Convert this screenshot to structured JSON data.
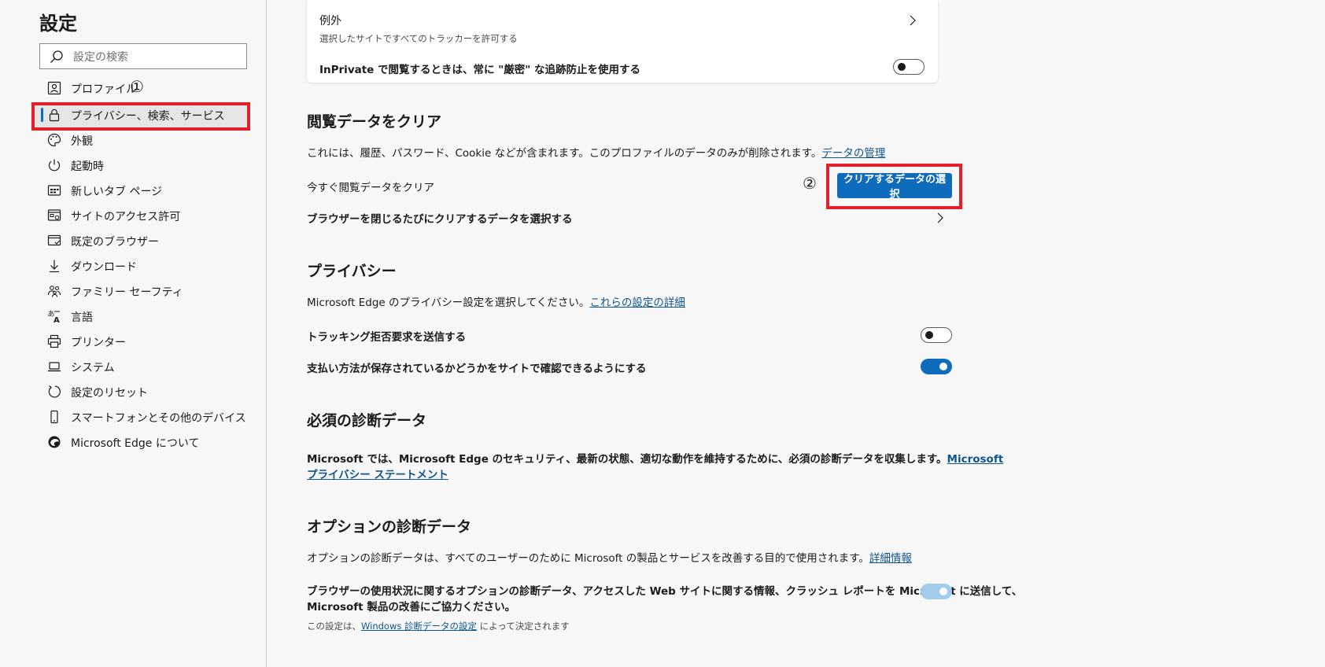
{
  "sidebar": {
    "title": "設定",
    "search": {
      "placeholder": "設定の検索"
    },
    "items": [
      {
        "label": "プロファイル",
        "icon": "profile-icon"
      },
      {
        "label": "プライバシー、検索、サービス",
        "icon": "lock-icon",
        "active": true
      },
      {
        "label": "外観",
        "icon": "palette-icon"
      },
      {
        "label": "起動時",
        "icon": "power-icon"
      },
      {
        "label": "新しいタブ ページ",
        "icon": "new-tab-icon"
      },
      {
        "label": "サイトのアクセス許可",
        "icon": "site-permissions-icon"
      },
      {
        "label": "既定のブラウザー",
        "icon": "default-browser-icon"
      },
      {
        "label": "ダウンロード",
        "icon": "download-icon"
      },
      {
        "label": "ファミリー セーフティ",
        "icon": "family-icon"
      },
      {
        "label": "言語",
        "icon": "language-icon"
      },
      {
        "label": "プリンター",
        "icon": "printer-icon"
      },
      {
        "label": "システム",
        "icon": "laptop-icon"
      },
      {
        "label": "設定のリセット",
        "icon": "reset-icon"
      },
      {
        "label": "スマートフォンとその他のデバイス",
        "icon": "phone-icon"
      },
      {
        "label": "Microsoft Edge について",
        "icon": "edge-logo-icon"
      }
    ]
  },
  "annotations": {
    "one": "①",
    "two": "②",
    "highlight_color": "#e3202a"
  },
  "main": {
    "exceptions": {
      "title": "例外",
      "subtitle": "選択したサイトですべてのトラッカーを許可する",
      "inprivate_label": "InPrivate で閲覧するときは、常に \"厳密\" な追跡防止を使用する",
      "inprivate_toggle": "off"
    },
    "clear_data": {
      "title": "閲覧データをクリア",
      "desc": "これには、履歴、パスワード、Cookie などが含まれます。このプロファイルのデータのみが削除されます。",
      "desc_link": "データの管理",
      "clear_now_label": "今すぐ閲覧データをクリア",
      "choose_button": "クリアするデータの選択",
      "on_close_label": "ブラウザーを閉じるたびにクリアするデータを選択する"
    },
    "privacy": {
      "title": "プライバシー",
      "desc": "Microsoft Edge のプライバシー設定を選択してください。",
      "desc_link": "これらの設定の詳細",
      "dnt_label": "トラッキング拒否要求を送信する",
      "dnt_toggle": "off",
      "payment_label": "支払い方法が保存されているかどうかをサイトで確認できるようにする",
      "payment_toggle": "on"
    },
    "required_diag": {
      "title": "必須の診断データ",
      "desc": "Microsoft では、Microsoft Edge のセキュリティ、最新の状態、適切な動作を維持するために、必須の診断データを収集します。",
      "link_part1": "Microsoft",
      "link_part2": "プライバシー ステートメント"
    },
    "optional_diag": {
      "title": "オプションの診断データ",
      "desc": "オプションの診断データは、すべてのユーザーのために Microsoft の製品とサービスを改善する目的で使用されます。",
      "desc_link": "詳細情報",
      "send_label_line1": "ブラウザーの使用状況に関するオプションの診断データ、アクセスした Web サイトに関する情報、クラッシュ レポートを Microsoft に送信して、",
      "send_label_line2": "Microsoft 製品の改善にご協力ください。",
      "send_toggle": "on-disabled",
      "note_prefix": "この設定は、",
      "note_link": "Windows 診断データの設定",
      "note_suffix": " によって決定されます"
    }
  },
  "colors": {
    "accent": "#0f6cbd",
    "link": "#0f548c",
    "toggle_disabled": "#a3cbea"
  }
}
